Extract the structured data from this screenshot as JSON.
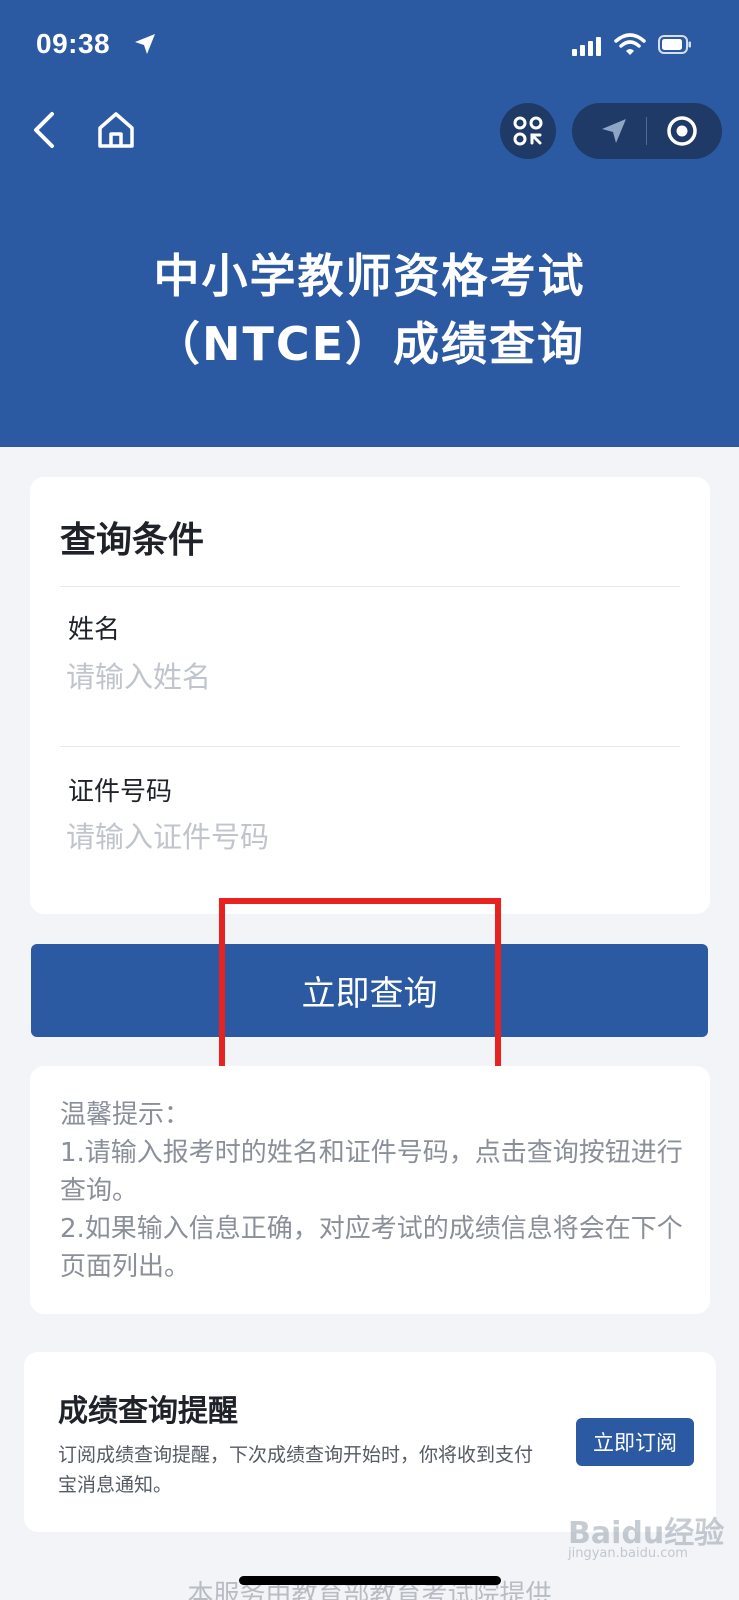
{
  "status_bar": {
    "time": "09:38"
  },
  "header": {
    "title_line1": "中小学教师资格考试",
    "title_line2": "（NTCE）成绩查询"
  },
  "query_card": {
    "title": "查询条件",
    "name_label": "姓名",
    "name_placeholder": "请输入姓名",
    "id_label": "证件号码",
    "id_placeholder": "请输入证件号码"
  },
  "query_button": {
    "label": "立即查询"
  },
  "tips": {
    "heading": "温馨提示：",
    "line1": "1.请输入报考时的姓名和证件号码，点击查询按钮进行查询。",
    "line2": "2.如果输入信息正确，对应考试的成绩信息将会在下个页面列出。"
  },
  "reminder": {
    "title": "成绩查询提醒",
    "description": "订阅成绩查询提醒，下次成绩查询开始时，你将收到支付宝消息通知。",
    "subscribe_label": "立即订阅"
  },
  "footer": {
    "text": "本服务由教育部教育考试院提供"
  },
  "watermark": {
    "brand": "Baidu经验",
    "url": "jingyan.baidu.com"
  },
  "colors": {
    "primary": "#2b5aa2",
    "highlight": "#e8221e",
    "background": "#f2f4f7"
  }
}
